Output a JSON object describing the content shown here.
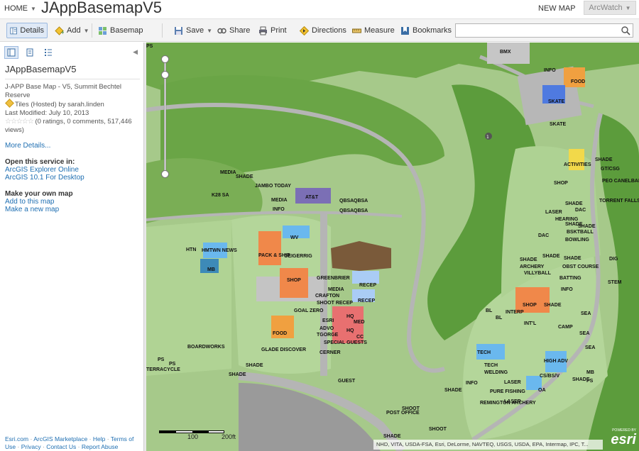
{
  "header": {
    "home_label": "HOME",
    "app_title": "JAppBasemapV5",
    "new_map_label": "NEW MAP",
    "user_label": "ArcWatch"
  },
  "toolbar": {
    "details_label": "Details",
    "add_label": "Add",
    "basemap_label": "Basemap",
    "save_label": "Save",
    "share_label": "Share",
    "print_label": "Print",
    "directions_label": "Directions",
    "measure_label": "Measure",
    "bookmarks_label": "Bookmarks",
    "search_placeholder": ""
  },
  "sidebar": {
    "item_title": "JAppBasemapV5",
    "description": "J-APP Base Map - V5, Summit Bechtel Reserve",
    "type_line": "Tiles (Hosted) by sarah.linden",
    "last_modified": "Last Modified: July 10, 2013",
    "ratings": "(0 ratings, 0 comments, 517,446 views)",
    "more_details": "More Details...",
    "open_heading": "Open this service in:",
    "open_links": [
      "ArcGIS Explorer Online",
      "ArcGIS 10.1 For Desktop"
    ],
    "make_heading": "Make your own map",
    "make_links": [
      "Add to this map",
      "Make a new map"
    ],
    "footer": {
      "esri_com": "Esri.com",
      "marketplace": "ArcGIS Marketplace",
      "help": "Help",
      "terms": "Terms of Use",
      "privacy": "Privacy",
      "contact": "Contact Us",
      "report": "Report Abuse"
    }
  },
  "map": {
    "scale_labels": [
      "100",
      "200ft"
    ],
    "attribution": "NHD, VITA, USDA-FSA, Esri, DeLorme, NAVTEQ, USGS, USDA, EPA, Intermap, IPC, T...",
    "logo_small": "POWERED BY",
    "logo_big": "esri",
    "labels": [
      "BMX",
      "FOOD",
      "INFO",
      "SKATE",
      "SKATE",
      "MEDIA",
      "SHADE",
      "K28 SA",
      "JAMBO TODAY",
      "MEDIA",
      "INFO",
      "AT&T",
      "QBSA",
      "QBSA",
      "QBSA",
      "QBSA",
      "WV",
      "HMTWN NEWS",
      "HTN",
      "MB",
      "PACK & SHIP",
      "GEIGERRIG",
      "SHOP",
      "GREENBRIER",
      "RECEP",
      "MEDIA",
      "RECEP",
      "CRAFTON",
      "SHOOT RECEP",
      "GOAL ZERO",
      "ESRI",
      "ADVO",
      "TGORGE",
      "HQ",
      "MED",
      "HQ",
      "CC",
      "SPECIAL GUESTS",
      "CERNER",
      "FOOD",
      "BOARDWORKS",
      "GLADE DISCOVER",
      "PS",
      "PS",
      "TERRACYCLE",
      "SHADE",
      "SHADE",
      "GUEST",
      "ACTIVITIES",
      "SHADE",
      "GT/CSG",
      "SHOP",
      "PEO CANELBAR",
      "SHADE",
      "TORRENT FALLS",
      "LASER",
      "DAC",
      "HEARING",
      "SHADE",
      "BSKTBALL",
      "SHADE",
      "DAC",
      "BOWLING",
      "SHADE",
      "SHADE",
      "SHADE",
      "ARCHERY",
      "VILLYBALL",
      "OBST COURSE",
      "BATTING",
      "INFO",
      "STEM",
      "DIG",
      "SHOP",
      "SHADE",
      "BL",
      "BL",
      "INTERP",
      "INT'L",
      "CAMP",
      "SEA",
      "SEA",
      "SEA",
      "TECH",
      "TECH",
      "WELDING",
      "HIGH ADV",
      "CS/BS/V",
      "OA",
      "INFO",
      "SHADE",
      "LASER",
      "LASER",
      "PURE FISHING",
      "REMINGTON ARCHERY",
      "POST OFFICE",
      "SHADE",
      "SHOOT",
      "SHOOT",
      "SHADE",
      "MB",
      "PS",
      "PS"
    ]
  },
  "colors": {
    "accent": "#1f6fb2",
    "grass": "#9cc37a",
    "forest": "#5a9e3a",
    "road": "#a8a8a8"
  },
  "icons": {
    "details": "details-icon",
    "add": "add-icon",
    "basemap": "basemap-icon",
    "save": "save-icon",
    "share": "share-icon",
    "print": "print-icon",
    "directions": "directions-icon",
    "measure": "measure-icon",
    "bookmarks": "bookmarks-icon",
    "search": "search-icon"
  }
}
